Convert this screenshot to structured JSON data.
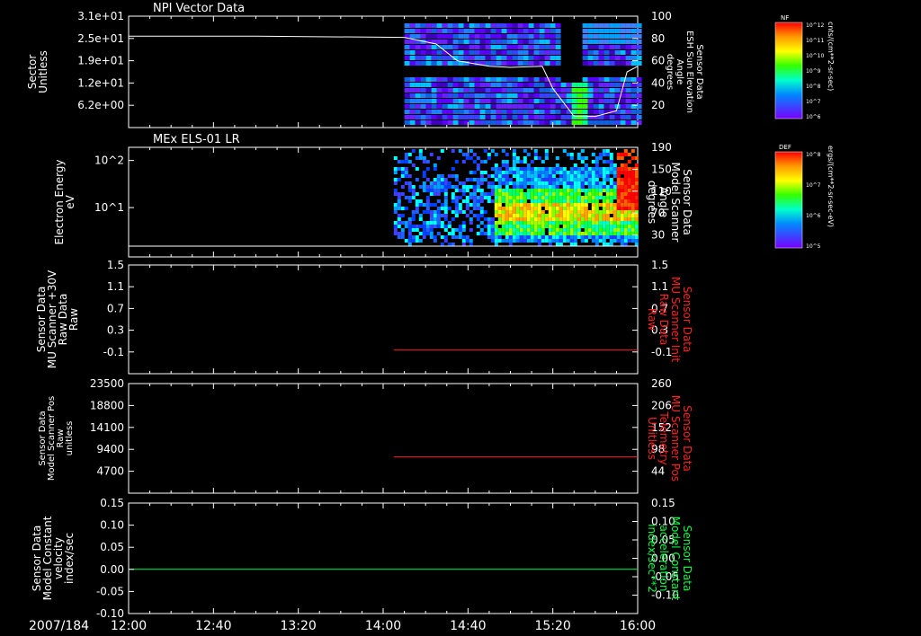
{
  "colors": {
    "background": "#000000",
    "frame": "#ffffff",
    "red_trace": "#ff2020",
    "green_trace": "#00ff40",
    "ylabel_red": "#ff2020",
    "ylabel_green": "#00ff40"
  },
  "time_axis": {
    "date_label": "2007/184",
    "tick_labels": [
      "12:00",
      "12:40",
      "13:20",
      "14:00",
      "14:40",
      "15:20",
      "16:00"
    ]
  },
  "chart_data": [
    {
      "type": "heatmap",
      "title": "NPI Vector Data",
      "ylabel_left": [
        "Sector",
        "Unitless"
      ],
      "ylabel_right": [
        "Sensor Data",
        "ESH Sun Elevation",
        "Angle",
        "degrees"
      ],
      "left_ticks": [
        "3.1e+01",
        "2.5e+01",
        "1.9e+01",
        "1.2e+01",
        "6.2e+00"
      ],
      "right_ticks": [
        "100",
        "80",
        "60",
        "40",
        "20"
      ],
      "ylim_right": [
        0,
        100
      ],
      "colorbar": {
        "label": "NF",
        "ticks": [
          "10^12",
          "10^11",
          "10^10",
          "10^9",
          "10^8",
          "10^7",
          "10^6"
        ],
        "units": "cnts/(cm**2-sr-sec)"
      },
      "data_start": "14:10",
      "series": [
        {
          "kind": "line",
          "axis": "right",
          "x": [
            "12:00",
            "13:00",
            "14:10",
            "14:25",
            "14:35",
            "14:50",
            "15:00",
            "15:15",
            "15:20",
            "15:30",
            "15:40",
            "15:50",
            "15:55",
            "16:00"
          ],
          "y": [
            82,
            82,
            81,
            75,
            60,
            55,
            54,
            55,
            35,
            10,
            10,
            15,
            50,
            55
          ]
        }
      ]
    },
    {
      "type": "heatmap",
      "title": "MEx ELS-01 LR",
      "ylabel_left": [
        "Electron Energy",
        "eV"
      ],
      "ylabel_right": [
        "Sensor Data",
        "Model Scanner",
        "Angle",
        "degrees"
      ],
      "left_ticks": [
        "10^2",
        "10^1"
      ],
      "right_ticks": [
        "190",
        "150",
        "110",
        "70",
        "30"
      ],
      "colorbar": {
        "label": "DEF",
        "ticks": [
          "10^8",
          "10^7",
          "10^6",
          "10^5"
        ],
        "units": "ergs/(cm**2-sr-sec-eV)"
      },
      "data_start": "14:05",
      "series": [
        {
          "kind": "line",
          "axis": "right",
          "x": [
            "12:00",
            "16:00"
          ],
          "y": [
            10,
            10
          ]
        }
      ]
    },
    {
      "type": "line",
      "ylabel_left": [
        "Sensor Data",
        "MU Scanner +30V",
        "Raw Data",
        "Raw"
      ],
      "ylabel_right": [
        "Sensor Data",
        "MU Scanner Init",
        "Raw Data",
        "Raw"
      ],
      "left_ticks": [
        "1.5",
        "1.1",
        "0.7",
        "0.3",
        "-0.1"
      ],
      "right_ticks": [
        "1.5",
        "1.1",
        "0.7",
        "0.3",
        "-0.1"
      ],
      "ylim": [
        -0.3,
        1.5
      ],
      "series": [
        {
          "kind": "line",
          "color": "#ff2020",
          "x": [
            "14:05",
            "16:00"
          ],
          "y": [
            0.0,
            0.0
          ]
        }
      ]
    },
    {
      "type": "line",
      "ylabel_left": [
        "Sensor Data",
        "Model Scanner Pos",
        "Raw",
        "unitless"
      ],
      "ylabel_right": [
        "Sensor Data",
        "MU Scanner Pos",
        "Telemetry",
        "Unitless"
      ],
      "left_ticks": [
        "23500",
        "18800",
        "14100",
        "9400",
        "4700"
      ],
      "right_ticks": [
        "260",
        "206",
        "152",
        "98",
        "44"
      ],
      "ylim_left": [
        0,
        23500
      ],
      "ylim_right": [
        0,
        260
      ],
      "series": [
        {
          "kind": "line",
          "color": "#ff2020",
          "axis": "right",
          "x": [
            "14:05",
            "16:00"
          ],
          "y": [
            86,
            86
          ]
        }
      ]
    },
    {
      "type": "line",
      "ylabel_left": [
        "Sensor Data",
        "Model Constant",
        "velocity",
        "index/sec"
      ],
      "ylabel_right": [
        "Sensor Data",
        "Model Constant",
        "acceleration",
        "index/sec**2"
      ],
      "left_ticks": [
        "0.15",
        "0.10",
        "0.05",
        "0.00",
        "-0.05",
        "-0.10"
      ],
      "right_ticks": [
        "0.15",
        "0.10",
        "0.05",
        "0.00",
        "-0.05",
        "-0.10"
      ],
      "ylim": [
        -0.1,
        0.15
      ],
      "series": [
        {
          "kind": "line",
          "color": "#00ff40",
          "x": [
            "12:00",
            "16:00"
          ],
          "y": [
            0.0,
            0.0
          ]
        }
      ]
    }
  ]
}
